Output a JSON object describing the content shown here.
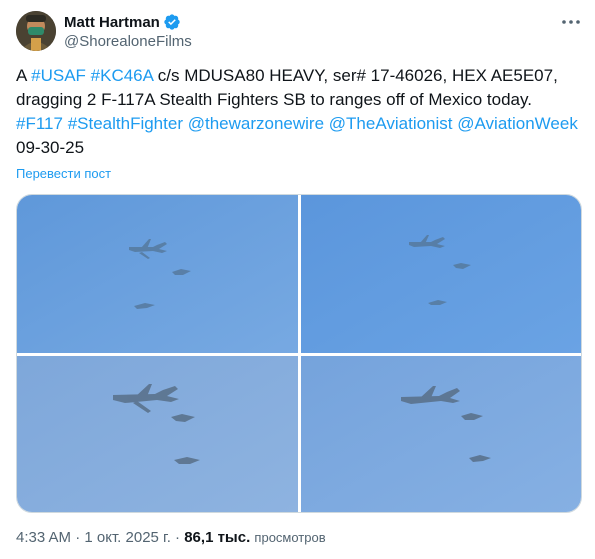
{
  "author": {
    "display_name": "Matt Hartman",
    "handle": "@ShorealoneFilms",
    "verified_icon": "verified-badge-icon",
    "more_icon": "more-options-icon"
  },
  "tweet": {
    "parts": [
      {
        "text": "A ",
        "link": false
      },
      {
        "text": "#USAF",
        "link": true
      },
      {
        "text": " ",
        "link": false
      },
      {
        "text": "#KC46A",
        "link": true
      },
      {
        "text": " c/s MDUSA80 HEAVY, ser# 17-46026, HEX AE5E07, dragging 2 F-117A Stealth Fighters SB to ranges off of Mexico today. ",
        "link": false
      },
      {
        "text": "#F117",
        "link": true
      },
      {
        "text": " ",
        "link": false
      },
      {
        "text": "#StealthFighter",
        "link": true
      },
      {
        "text": " ",
        "link": false
      },
      {
        "text": "@thewarzonewire",
        "link": true
      },
      {
        "text": " ",
        "link": false
      },
      {
        "text": "@TheAviationist",
        "link": true
      },
      {
        "text": " ",
        "link": false
      },
      {
        "text": "@AviationWeek",
        "link": true
      },
      {
        "text": " 09-30-25",
        "link": false
      }
    ],
    "translate_label": "Перевести пост"
  },
  "media": {
    "colors": {
      "sky_top_left": "#6ba0de",
      "sky_top_right": "#5f9be0",
      "sky_bottom_left": "#85acdc",
      "sky_bottom_right": "#7aa6de",
      "aircraft": "#4f6c8c"
    }
  },
  "meta": {
    "time": "4:33 AM",
    "separator": " · ",
    "date": "1 окт. 2025 г.",
    "views_count": "86,1 тыс.",
    "views_label": "просмотров"
  }
}
